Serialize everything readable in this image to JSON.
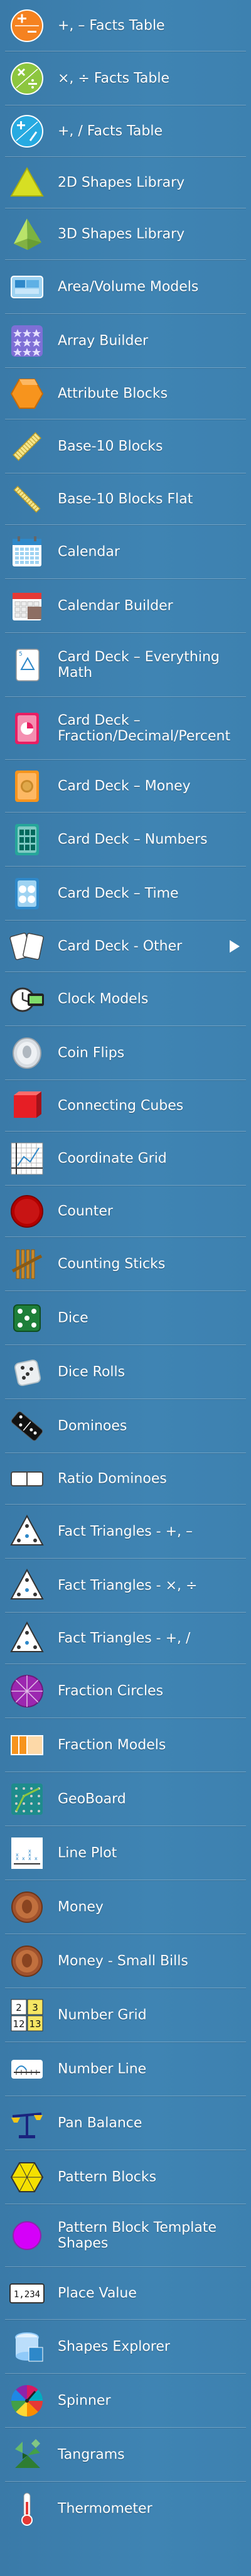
{
  "menu": {
    "items": [
      {
        "label": "+, – Facts Table",
        "icon": "plus-minus-icon"
      },
      {
        "label": "×, ÷ Facts Table",
        "icon": "times-divide-icon"
      },
      {
        "label": "+, / Facts Table",
        "icon": "plus-slash-icon"
      },
      {
        "label": "2D Shapes Library",
        "icon": "triangle-icon"
      },
      {
        "label": "3D Shapes Library",
        "icon": "pyramid-icon"
      },
      {
        "label": "Area/Volume Models",
        "icon": "area-model-icon"
      },
      {
        "label": "Array Builder",
        "icon": "array-grid-icon"
      },
      {
        "label": "Attribute Blocks",
        "icon": "hexagon-block-icon"
      },
      {
        "label": "Base-10 Blocks",
        "icon": "rod-icon"
      },
      {
        "label": "Base-10 Blocks Flat",
        "icon": "flat-rod-icon"
      },
      {
        "label": "Calendar",
        "icon": "calendar-icon"
      },
      {
        "label": "Calendar Builder",
        "icon": "calendar-builder-icon"
      },
      {
        "label": "Card Deck – Everything Math",
        "icon": "card-deck-icon"
      },
      {
        "label": "Card Deck – Fraction/Decimal/Percent",
        "icon": "fraction-card-icon"
      },
      {
        "label": "Card Deck – Money",
        "icon": "money-card-icon"
      },
      {
        "label": "Card Deck – Numbers",
        "icon": "numbers-card-icon"
      },
      {
        "label": "Card Deck – Time",
        "icon": "time-card-icon"
      },
      {
        "label": "Card Deck - Other",
        "icon": "cards-icon"
      },
      {
        "label": "Clock Models",
        "icon": "clock-icon"
      },
      {
        "label": "Coin Flips",
        "icon": "coin-icon"
      },
      {
        "label": "Connecting Cubes",
        "icon": "cube-icon"
      },
      {
        "label": "Coordinate Grid",
        "icon": "coordinate-grid-icon"
      },
      {
        "label": "Counter",
        "icon": "counter-icon"
      },
      {
        "label": "Counting Sticks",
        "icon": "sticks-icon"
      },
      {
        "label": "Dice",
        "icon": "dice-icon"
      },
      {
        "label": "Dice Rolls",
        "icon": "dice-roll-icon"
      },
      {
        "label": "Dominoes",
        "icon": "domino-icon"
      },
      {
        "label": "Ratio Dominoes",
        "icon": "ratio-domino-icon"
      },
      {
        "label": "Fact Triangles - +, –",
        "icon": "fact-triangle-icon"
      },
      {
        "label": "Fact Triangles - ×, ÷",
        "icon": "fact-triangle-icon"
      },
      {
        "label": "Fact Triangles - +, /",
        "icon": "fact-triangle-icon"
      },
      {
        "label": "Fraction Circles",
        "icon": "fraction-circle-icon"
      },
      {
        "label": "Fraction Models",
        "icon": "fraction-model-icon"
      },
      {
        "label": "GeoBoard",
        "icon": "geoboard-icon"
      },
      {
        "label": "Line Plot",
        "icon": "line-plot-icon"
      },
      {
        "label": "Money",
        "icon": "money-icon"
      },
      {
        "label": "Money - Small Bills",
        "icon": "money-icon"
      },
      {
        "label": "Number Grid",
        "icon": "number-grid-icon"
      },
      {
        "label": "Number Line",
        "icon": "number-line-icon"
      },
      {
        "label": "Pan Balance",
        "icon": "balance-icon"
      },
      {
        "label": "Pattern Blocks",
        "icon": "pattern-blocks-icon"
      },
      {
        "label": "Pattern Block Template Shapes",
        "icon": "pattern-template-icon"
      },
      {
        "label": "Place Value",
        "icon": "place-value-icon"
      },
      {
        "label": "Shapes Explorer",
        "icon": "shapes-explorer-icon"
      },
      {
        "label": "Spinner",
        "icon": "spinner-icon"
      },
      {
        "label": "Tangrams",
        "icon": "tangram-icon"
      },
      {
        "label": "Thermometer",
        "icon": "thermometer-icon"
      }
    ],
    "submenu_indicator": "chevron-right-icon"
  },
  "colors": {
    "background": "#3d81b0",
    "text": "#ffffff",
    "divider": "#7aa9cb"
  },
  "icon_text": {
    "number_grid": [
      "2",
      "3",
      "12",
      "13"
    ],
    "place_value": "1,234"
  }
}
